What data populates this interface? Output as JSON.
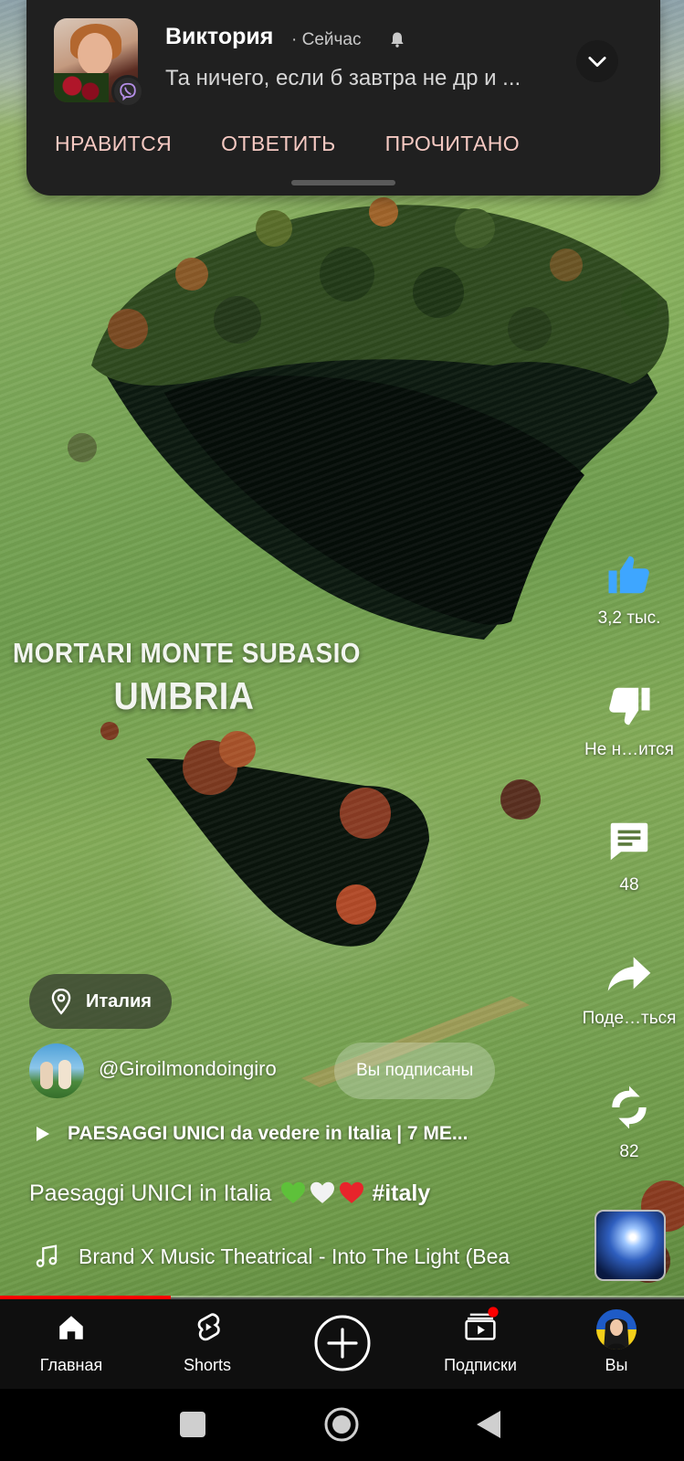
{
  "notification": {
    "sender": "Виктория",
    "time": "· Сейчас",
    "message": "Та ничего, если б завтра не др и ...",
    "actions": [
      "НРАВИТСЯ",
      "ОТВЕТИТЬ",
      "ПРОЧИТАНО"
    ],
    "app_icon": "viber-icon"
  },
  "video": {
    "overlay_line1": "MORTARI MONTE SUBASIO",
    "overlay_line2": "UMBRIA",
    "progress_fraction": 0.25
  },
  "actions": {
    "like_count": "3,2 тыс.",
    "dislike_label": "Не н…ится",
    "comments_count": "48",
    "share_label": "Поде…ться",
    "remix_count": "82"
  },
  "info": {
    "location": "Италия",
    "channel": "@Giroilmondoingiro",
    "subscribe_state": "Вы подписаны",
    "related_video": "PAESAGGI UNICI da vedere in Italia | 7 ME...",
    "description_text": "Paesaggi UNICI in Italia",
    "description_hashtag": "#italy",
    "music": "Brand X Music Theatrical - Into The Light (Bea"
  },
  "nav": {
    "home": "Главная",
    "shorts": "Shorts",
    "subscriptions": "Подписки",
    "you": "Вы"
  },
  "colors": {
    "accent_red": "#ff0000",
    "like_blue": "#3ea6ff",
    "notif_bg": "#202020",
    "notif_action": "#f5c9c2"
  }
}
